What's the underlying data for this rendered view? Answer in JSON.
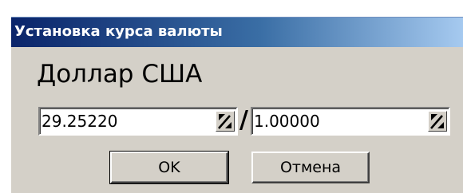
{
  "window": {
    "title": "Установка курса валюты"
  },
  "currency": {
    "name": "Доллар США"
  },
  "rate": {
    "left_value": "29.25220",
    "separator": "/",
    "right_value": "1.00000"
  },
  "buttons": {
    "ok_label": "OK",
    "cancel_label": "Отмена"
  },
  "colors": {
    "titlebar_start": "#0a246a",
    "titlebar_end": "#a6caf0",
    "dialog_face": "#d4d0c8"
  },
  "icons": {
    "spin": "spin-updown-icon"
  }
}
